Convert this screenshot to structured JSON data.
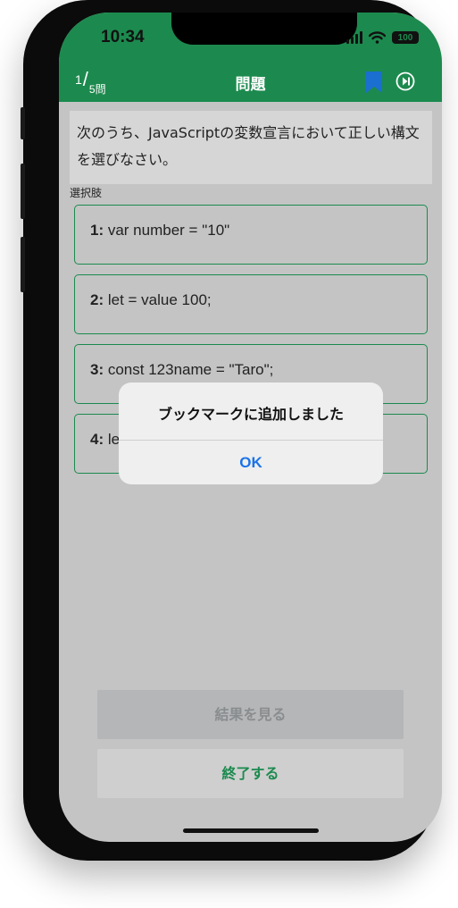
{
  "status_bar": {
    "time": "10:34",
    "battery": "100"
  },
  "nav": {
    "counter_current": "1",
    "counter_slash": "/",
    "counter_total": "5問",
    "title": "問題"
  },
  "question": {
    "text": "次のうち、JavaScriptの変数宣言において正しい構文を選びなさい。"
  },
  "choices_label": "選択肢",
  "choices": [
    {
      "number": "1:",
      "text": " var number = \"10\""
    },
    {
      "number": "2:",
      "text": " let = value 100;"
    },
    {
      "number": "3:",
      "text": " const 123name = \"Taro\";"
    },
    {
      "number": "4:",
      "text": " le"
    }
  ],
  "buttons": {
    "result": "結果を見る",
    "end": "終了する"
  },
  "alert": {
    "message": "ブックマークに追加しました",
    "ok": "OK"
  },
  "colors": {
    "header": "#1c8a4e",
    "bookmark": "#1a6fd0",
    "accent_green": "#1c8a4e",
    "link_blue": "#1a73e8"
  },
  "icons": {
    "bookmark": "bookmark-icon",
    "next": "skip-next-icon",
    "signal": "cellular-signal-icon",
    "wifi": "wifi-icon",
    "battery": "battery-icon"
  }
}
